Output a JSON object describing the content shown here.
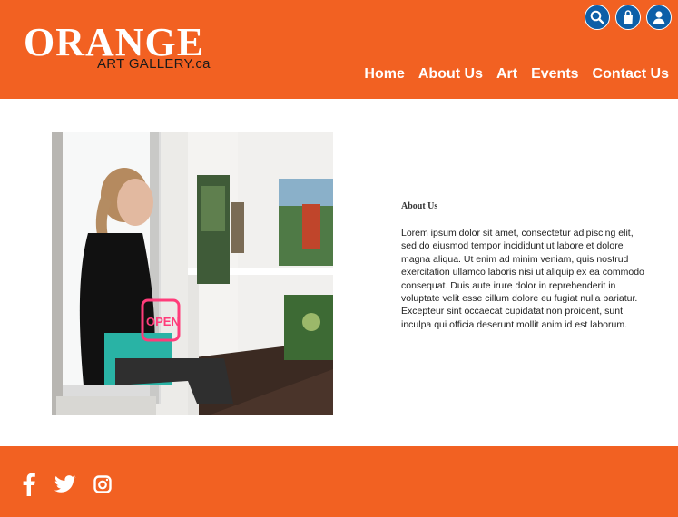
{
  "brand": {
    "name": "ORANGE",
    "subtitle": "ART GALLERY.ca",
    "color": "#f26122"
  },
  "header_icons": [
    {
      "icon": "search-icon"
    },
    {
      "icon": "shopping-bag-icon"
    },
    {
      "icon": "user-icon"
    }
  ],
  "nav": {
    "items": [
      "Home",
      "About Us",
      "Art",
      "Events",
      "Contact Us"
    ]
  },
  "about": {
    "title": "About Us",
    "body": "Lorem ipsum dolor sit amet, consectetur adipiscing elit, sed do eiusmod tempor incididunt ut labore et dolore magna aliqua. Ut enim ad minim veniam, quis nostrud exercitation ullamco laboris nisi ut aliquip ex ea commodo consequat. Duis aute irure dolor in reprehenderit in voluptate velit esse cillum dolore eu fugiat nulla pariatur. Excepteur sint occaecat cupidatat non proident, sunt inculpa qui officia deserunt mollit anim id est laborum."
  },
  "photo": {
    "sign_text": "OPEN"
  },
  "footer": {
    "social": [
      "facebook-icon",
      "twitter-icon",
      "instagram-icon"
    ]
  }
}
